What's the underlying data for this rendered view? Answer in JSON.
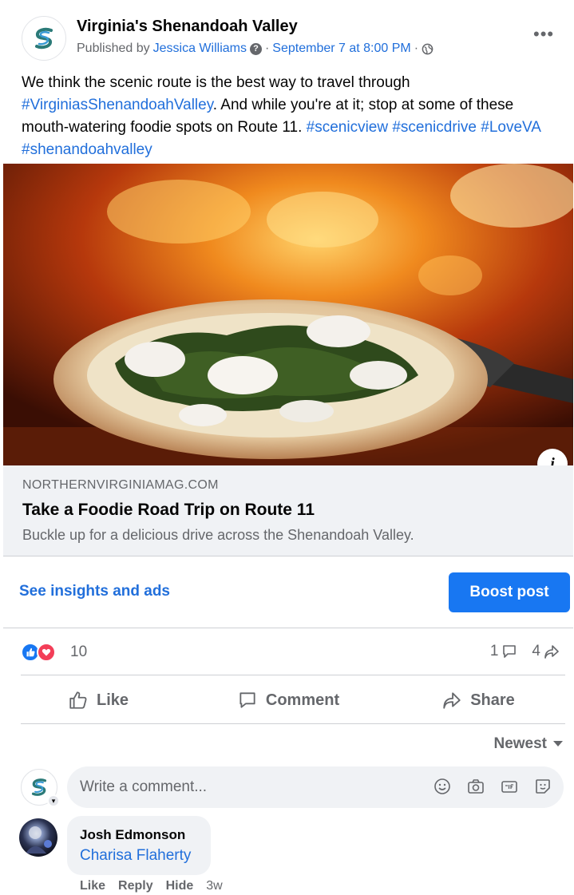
{
  "post": {
    "page_name": "Virginia's Shenandoah Valley",
    "published_by_prefix": "Published by",
    "author": "Jessica Williams",
    "dot": "·",
    "date": "September 7 at 8:00 PM",
    "body_parts": [
      {
        "text": "We think the scenic route is the best way to travel through ",
        "link": false
      },
      {
        "text": "#VirginiasShenandoahValley",
        "link": true
      },
      {
        "text": ". And while you're at it; stop at some of these mouth-watering foodie spots on Route 11. ",
        "link": false
      },
      {
        "text": "#scenicview",
        "link": true
      },
      {
        "text": " ",
        "link": false
      },
      {
        "text": "#scenicdrive",
        "link": true
      },
      {
        "text": " ",
        "link": false
      },
      {
        "text": "#LoveVA",
        "link": true
      },
      {
        "text": " ",
        "link": false
      },
      {
        "text": "#shenandoahvalley",
        "link": true
      }
    ]
  },
  "preview": {
    "domain": "NORTHERNVIRGINIAMAG.COM",
    "title": "Take a Foodie Road Trip on Route 11",
    "description": "Buckle up for a delicious drive across the Shenandoah Valley.",
    "info_label": "i"
  },
  "insights": {
    "see_insights": "See insights and ads",
    "boost": "Boost post"
  },
  "stats": {
    "reactions": "10",
    "comments": "1",
    "shares": "4"
  },
  "actions": {
    "like": "Like",
    "comment": "Comment",
    "share": "Share"
  },
  "sort": {
    "label": "Newest"
  },
  "composer": {
    "placeholder": "Write a comment..."
  },
  "comment": {
    "author": "Josh Edmonson",
    "text": "Charisa Flaherty",
    "like": "Like",
    "reply": "Reply",
    "hide": "Hide",
    "time": "3w"
  },
  "colors": {
    "brand_blue": "#1877f2",
    "link_blue": "#216fdb",
    "secondary_text": "#65676b",
    "love_red": "#f33e58"
  }
}
